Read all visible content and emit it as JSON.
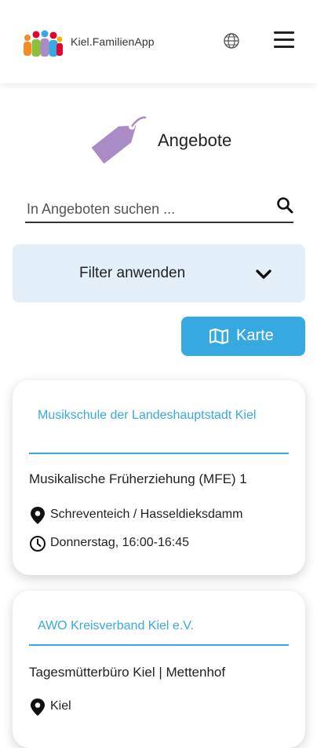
{
  "header": {
    "app_name": "Kiel.FamilienApp",
    "logo_icon": "family-people-logo",
    "language_icon": "globe-icon",
    "menu_icon": "hamburger-menu-icon"
  },
  "page": {
    "icon": "price-tag-icon",
    "title": "Angebote"
  },
  "search": {
    "placeholder": "In Angeboten suchen ...",
    "value": "",
    "icon": "search-icon"
  },
  "filter": {
    "label": "Filter anwenden",
    "icon": "chevron-down-icon"
  },
  "map_button": {
    "label": "Karte",
    "icon": "map-icon"
  },
  "colors": {
    "accent": "#36a9e1",
    "filter_bg": "#e2eff8",
    "tag_purple": "#a98bc6"
  },
  "offers": [
    {
      "provider": "Musikschule der Landeshauptstadt Kiel",
      "title": "Musikalische Früherziehung (MFE) 1",
      "location": "Schreventeich / Hasseldieksdamm",
      "time": "Donnerstag, 16:00-16:45"
    },
    {
      "provider": "AWO Kreisverband Kiel e.V.",
      "title": "Tagesmütterbüro Kiel | Mettenhof",
      "location": "Kiel"
    }
  ]
}
